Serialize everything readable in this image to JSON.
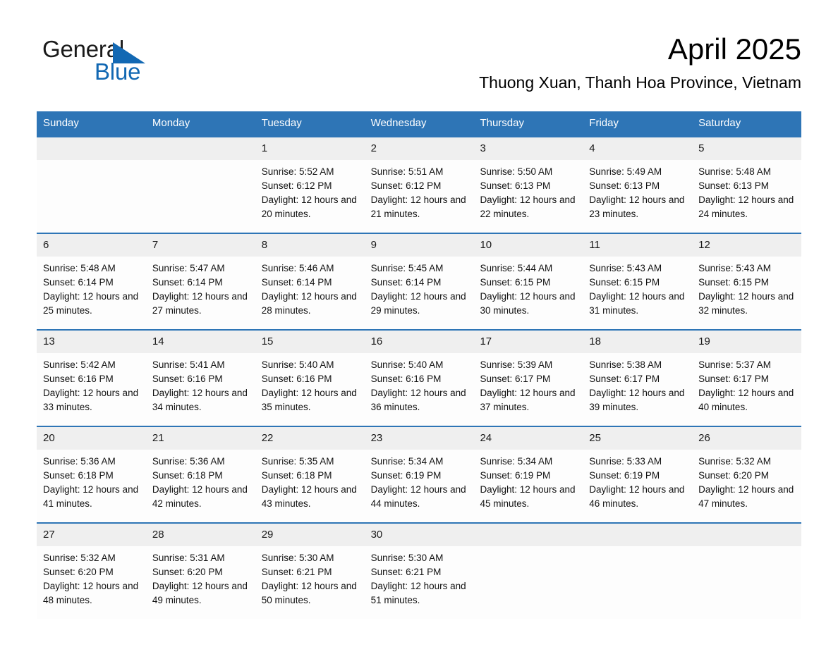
{
  "brand": {
    "logo_word_1": "General",
    "logo_word_2": "Blue",
    "logo_triangle_icon": "triangle-icon",
    "accent_color": "#1268b3",
    "header_color": "#2e75b6",
    "daynum_band_color": "#efefef"
  },
  "header": {
    "month_title": "April 2025",
    "location": "Thuong Xuan, Thanh Hoa Province, Vietnam"
  },
  "calendar": {
    "weekday_headers": [
      "Sunday",
      "Monday",
      "Tuesday",
      "Wednesday",
      "Thursday",
      "Friday",
      "Saturday"
    ],
    "weeks": [
      {
        "days": [
          {
            "date": "",
            "sunrise": "",
            "sunset": "",
            "daylight": ""
          },
          {
            "date": "",
            "sunrise": "",
            "sunset": "",
            "daylight": ""
          },
          {
            "date": "1",
            "sunrise": "Sunrise: 5:52 AM",
            "sunset": "Sunset: 6:12 PM",
            "daylight": "Daylight: 12 hours and 20 minutes."
          },
          {
            "date": "2",
            "sunrise": "Sunrise: 5:51 AM",
            "sunset": "Sunset: 6:12 PM",
            "daylight": "Daylight: 12 hours and 21 minutes."
          },
          {
            "date": "3",
            "sunrise": "Sunrise: 5:50 AM",
            "sunset": "Sunset: 6:13 PM",
            "daylight": "Daylight: 12 hours and 22 minutes."
          },
          {
            "date": "4",
            "sunrise": "Sunrise: 5:49 AM",
            "sunset": "Sunset: 6:13 PM",
            "daylight": "Daylight: 12 hours and 23 minutes."
          },
          {
            "date": "5",
            "sunrise": "Sunrise: 5:48 AM",
            "sunset": "Sunset: 6:13 PM",
            "daylight": "Daylight: 12 hours and 24 minutes."
          }
        ]
      },
      {
        "days": [
          {
            "date": "6",
            "sunrise": "Sunrise: 5:48 AM",
            "sunset": "Sunset: 6:14 PM",
            "daylight": "Daylight: 12 hours and 25 minutes."
          },
          {
            "date": "7",
            "sunrise": "Sunrise: 5:47 AM",
            "sunset": "Sunset: 6:14 PM",
            "daylight": "Daylight: 12 hours and 27 minutes."
          },
          {
            "date": "8",
            "sunrise": "Sunrise: 5:46 AM",
            "sunset": "Sunset: 6:14 PM",
            "daylight": "Daylight: 12 hours and 28 minutes."
          },
          {
            "date": "9",
            "sunrise": "Sunrise: 5:45 AM",
            "sunset": "Sunset: 6:14 PM",
            "daylight": "Daylight: 12 hours and 29 minutes."
          },
          {
            "date": "10",
            "sunrise": "Sunrise: 5:44 AM",
            "sunset": "Sunset: 6:15 PM",
            "daylight": "Daylight: 12 hours and 30 minutes."
          },
          {
            "date": "11",
            "sunrise": "Sunrise: 5:43 AM",
            "sunset": "Sunset: 6:15 PM",
            "daylight": "Daylight: 12 hours and 31 minutes."
          },
          {
            "date": "12",
            "sunrise": "Sunrise: 5:43 AM",
            "sunset": "Sunset: 6:15 PM",
            "daylight": "Daylight: 12 hours and 32 minutes."
          }
        ]
      },
      {
        "days": [
          {
            "date": "13",
            "sunrise": "Sunrise: 5:42 AM",
            "sunset": "Sunset: 6:16 PM",
            "daylight": "Daylight: 12 hours and 33 minutes."
          },
          {
            "date": "14",
            "sunrise": "Sunrise: 5:41 AM",
            "sunset": "Sunset: 6:16 PM",
            "daylight": "Daylight: 12 hours and 34 minutes."
          },
          {
            "date": "15",
            "sunrise": "Sunrise: 5:40 AM",
            "sunset": "Sunset: 6:16 PM",
            "daylight": "Daylight: 12 hours and 35 minutes."
          },
          {
            "date": "16",
            "sunrise": "Sunrise: 5:40 AM",
            "sunset": "Sunset: 6:16 PM",
            "daylight": "Daylight: 12 hours and 36 minutes."
          },
          {
            "date": "17",
            "sunrise": "Sunrise: 5:39 AM",
            "sunset": "Sunset: 6:17 PM",
            "daylight": "Daylight: 12 hours and 37 minutes."
          },
          {
            "date": "18",
            "sunrise": "Sunrise: 5:38 AM",
            "sunset": "Sunset: 6:17 PM",
            "daylight": "Daylight: 12 hours and 39 minutes."
          },
          {
            "date": "19",
            "sunrise": "Sunrise: 5:37 AM",
            "sunset": "Sunset: 6:17 PM",
            "daylight": "Daylight: 12 hours and 40 minutes."
          }
        ]
      },
      {
        "days": [
          {
            "date": "20",
            "sunrise": "Sunrise: 5:36 AM",
            "sunset": "Sunset: 6:18 PM",
            "daylight": "Daylight: 12 hours and 41 minutes."
          },
          {
            "date": "21",
            "sunrise": "Sunrise: 5:36 AM",
            "sunset": "Sunset: 6:18 PM",
            "daylight": "Daylight: 12 hours and 42 minutes."
          },
          {
            "date": "22",
            "sunrise": "Sunrise: 5:35 AM",
            "sunset": "Sunset: 6:18 PM",
            "daylight": "Daylight: 12 hours and 43 minutes."
          },
          {
            "date": "23",
            "sunrise": "Sunrise: 5:34 AM",
            "sunset": "Sunset: 6:19 PM",
            "daylight": "Daylight: 12 hours and 44 minutes."
          },
          {
            "date": "24",
            "sunrise": "Sunrise: 5:34 AM",
            "sunset": "Sunset: 6:19 PM",
            "daylight": "Daylight: 12 hours and 45 minutes."
          },
          {
            "date": "25",
            "sunrise": "Sunrise: 5:33 AM",
            "sunset": "Sunset: 6:19 PM",
            "daylight": "Daylight: 12 hours and 46 minutes."
          },
          {
            "date": "26",
            "sunrise": "Sunrise: 5:32 AM",
            "sunset": "Sunset: 6:20 PM",
            "daylight": "Daylight: 12 hours and 47 minutes."
          }
        ]
      },
      {
        "days": [
          {
            "date": "27",
            "sunrise": "Sunrise: 5:32 AM",
            "sunset": "Sunset: 6:20 PM",
            "daylight": "Daylight: 12 hours and 48 minutes."
          },
          {
            "date": "28",
            "sunrise": "Sunrise: 5:31 AM",
            "sunset": "Sunset: 6:20 PM",
            "daylight": "Daylight: 12 hours and 49 minutes."
          },
          {
            "date": "29",
            "sunrise": "Sunrise: 5:30 AM",
            "sunset": "Sunset: 6:21 PM",
            "daylight": "Daylight: 12 hours and 50 minutes."
          },
          {
            "date": "30",
            "sunrise": "Sunrise: 5:30 AM",
            "sunset": "Sunset: 6:21 PM",
            "daylight": "Daylight: 12 hours and 51 minutes."
          },
          {
            "date": "",
            "sunrise": "",
            "sunset": "",
            "daylight": ""
          },
          {
            "date": "",
            "sunrise": "",
            "sunset": "",
            "daylight": ""
          },
          {
            "date": "",
            "sunrise": "",
            "sunset": "",
            "daylight": ""
          }
        ]
      }
    ]
  }
}
